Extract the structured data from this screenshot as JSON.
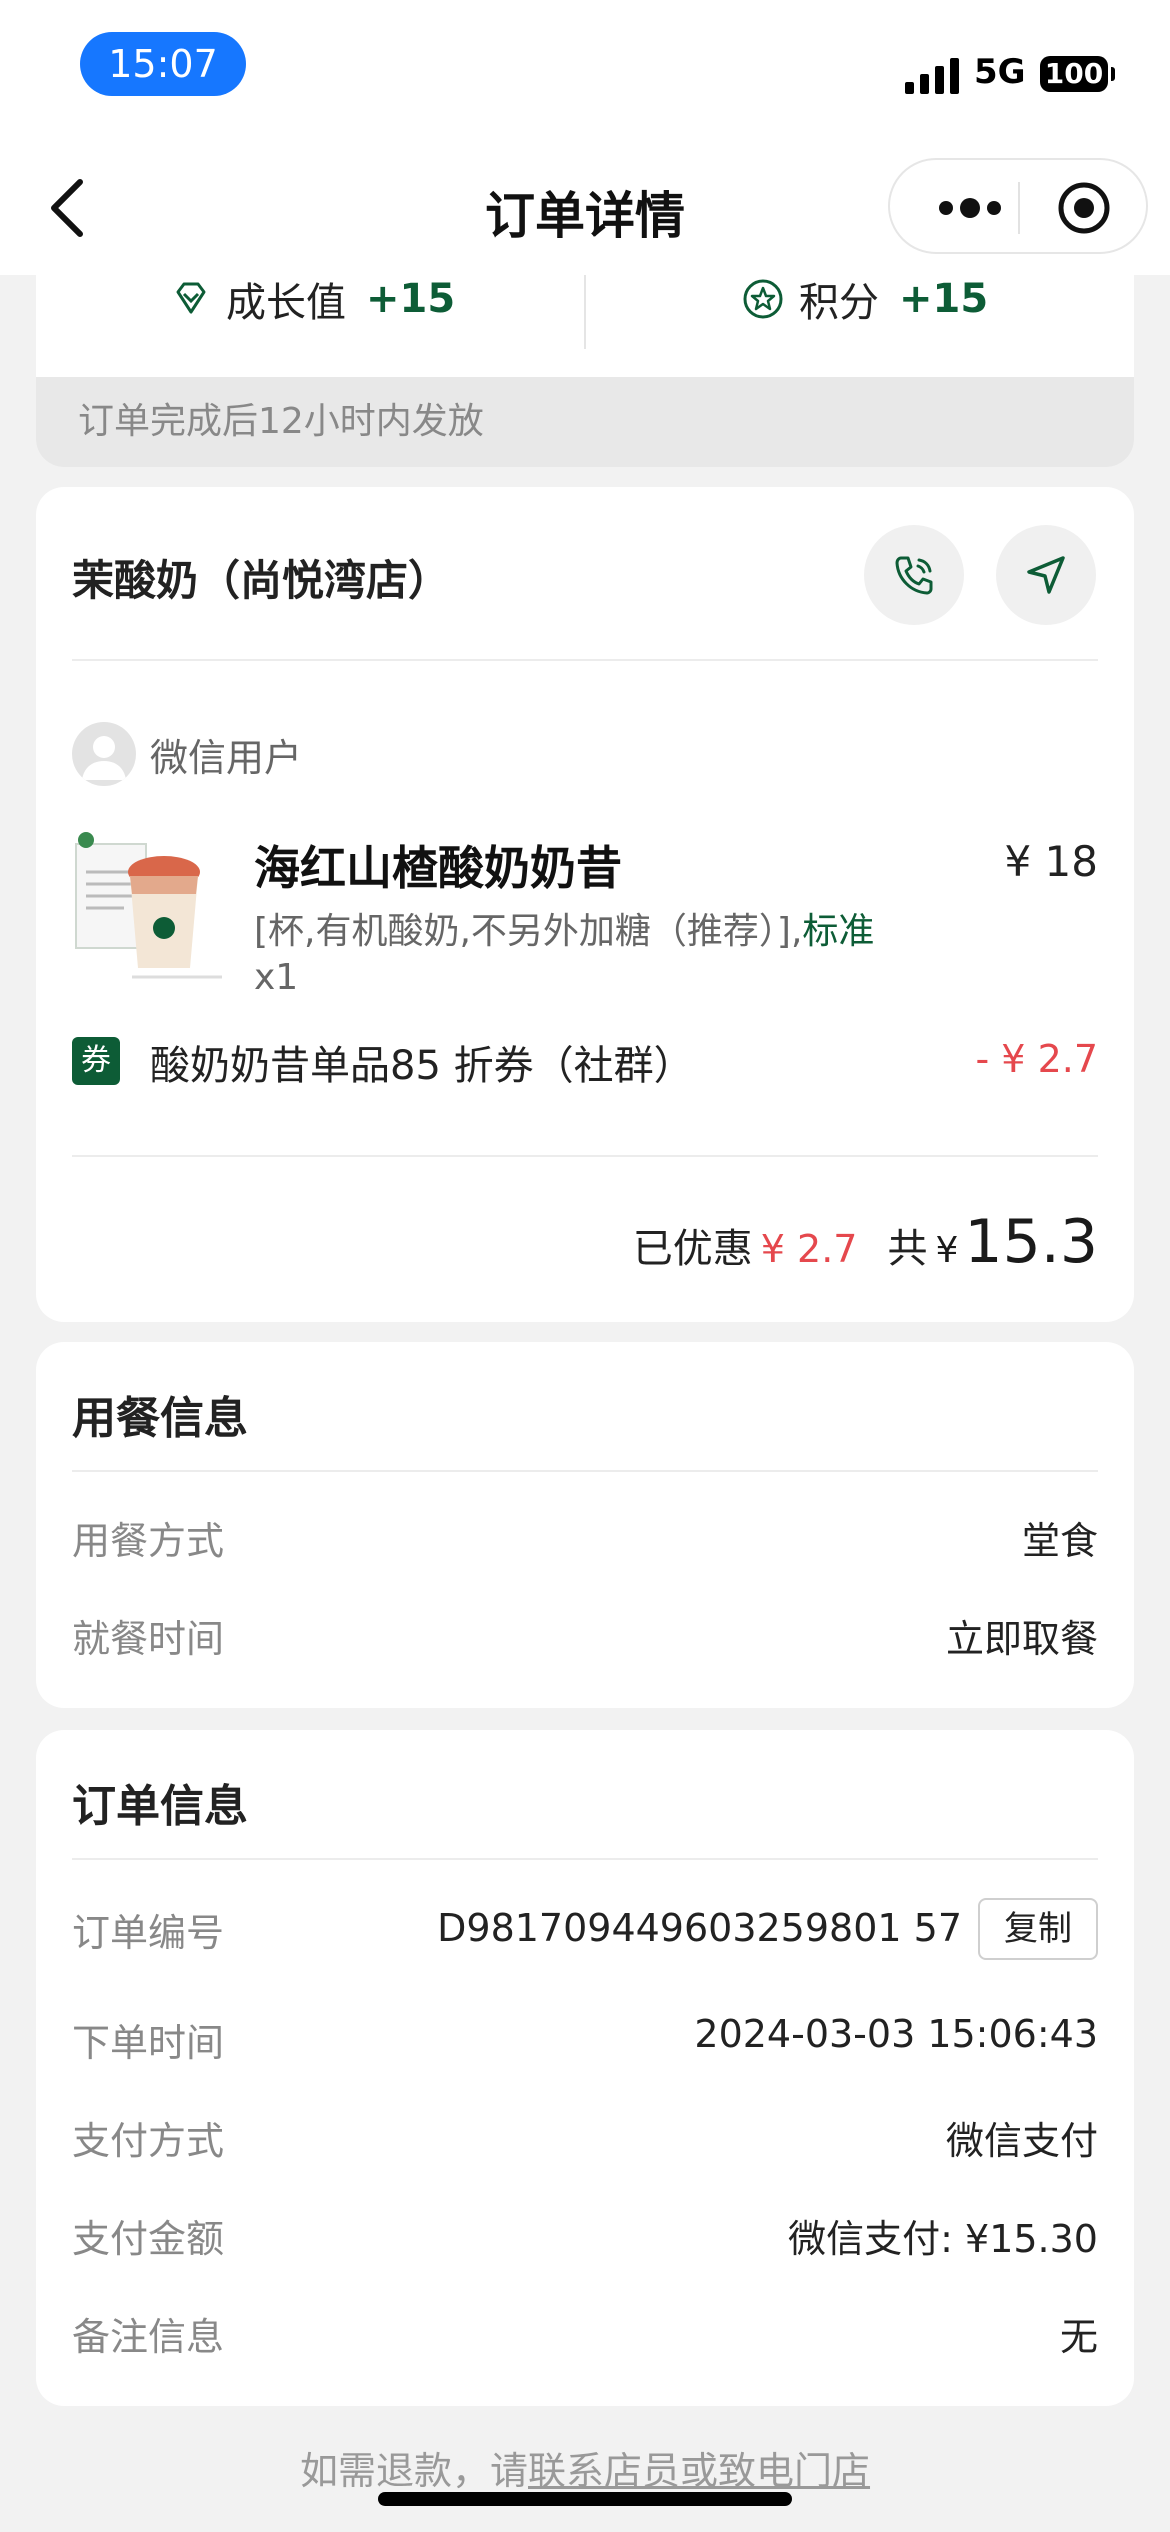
{
  "status_bar": {
    "time": "15:07",
    "network": "5G",
    "battery": "100"
  },
  "nav": {
    "title": "订单详情"
  },
  "rewards": {
    "growth": {
      "label": "成长值",
      "value": "+15"
    },
    "points": {
      "label": "积分",
      "value": "+15"
    },
    "note": "订单完成后12小时内发放"
  },
  "store": {
    "name": "茉酸奶（尚悦湾店）",
    "user": "微信用户",
    "product": {
      "name": "海红山楂酸奶奶昔",
      "price": "¥ 18",
      "options": "[杯,有机酸奶,不另外加糖（推荐）],",
      "spec": "标准",
      "qty": "x1"
    },
    "coupon": {
      "badge": "券",
      "name": "酸奶奶昔单品85 折券（社群）",
      "amount": "- ¥ 2.7"
    },
    "summary": {
      "discount_label": "已优惠",
      "discount_amount": "¥ 2.7",
      "total_label": "共",
      "currency": "¥",
      "total": "15.3"
    }
  },
  "dining": {
    "title": "用餐信息",
    "mode_label": "用餐方式",
    "mode_value": "堂食",
    "time_label": "就餐时间",
    "time_value": "立即取餐"
  },
  "order": {
    "title": "订单信息",
    "number_label": "订单编号",
    "number_value": "D981709449603259801 57",
    "copy_label": "复制",
    "created_label": "下单时间",
    "created_value": "2024-03-03 15:06:43",
    "pay_method_label": "支付方式",
    "pay_method_value": "微信支付",
    "pay_amount_label": "支付金额",
    "pay_amount_value": "微信支付: ¥15.30",
    "remark_label": "备注信息",
    "remark_value": "无"
  },
  "footer": {
    "prefix": "如需退款，请",
    "link": "联系店员或致电门店"
  },
  "colors": {
    "brand_green": "#0d5c36",
    "discount_red": "#e5484d",
    "status_pill": "#1677ff"
  }
}
